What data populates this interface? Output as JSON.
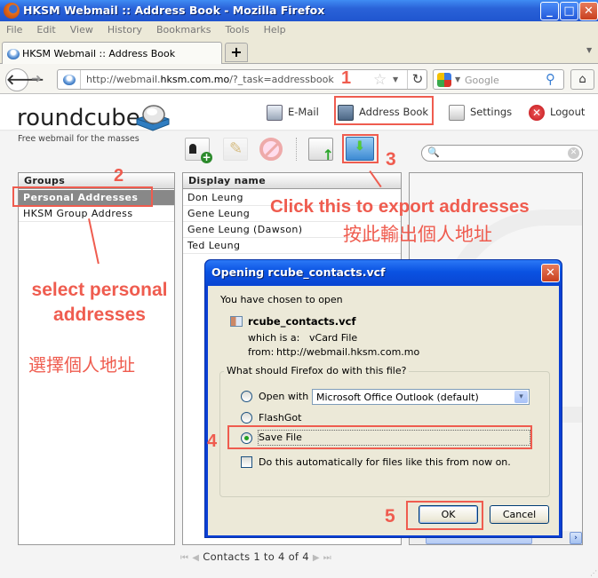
{
  "window": {
    "title": "HKSM Webmail :: Address Book - Mozilla Firefox",
    "controls": {
      "minimize": "_",
      "maximize": "□",
      "close": "✕"
    }
  },
  "menubar": {
    "items": [
      "File",
      "Edit",
      "View",
      "History",
      "Bookmarks",
      "Tools",
      "Help"
    ]
  },
  "tabs": {
    "items": [
      {
        "label": "HKSM Webmail :: Address Book"
      }
    ],
    "new_tab": "+",
    "overflow": "▼"
  },
  "navbar": {
    "back": "🡐",
    "forward": "➜",
    "url_prefix": "http://webmail.",
    "url_domain": "hksm.com.mo",
    "url_suffix": "/?_task=addressbook",
    "star": "☆",
    "dropdown": "▼",
    "reload": "↻",
    "search_placeholder": "Google",
    "search_dropdown": "▼",
    "search_icon": "⚲",
    "home": "⌂"
  },
  "roundcube": {
    "logo": "roundcube",
    "tagline": "Free webmail for the masses",
    "nav": [
      {
        "label": "E-Mail"
      },
      {
        "label": "Address Book"
      },
      {
        "label": "Settings"
      },
      {
        "label": "Logout",
        "icon_glyph": "✕"
      }
    ],
    "search_icon": "🔍",
    "search_reset": "✕"
  },
  "groups": {
    "header": "Groups",
    "items": [
      {
        "label": "Personal Addresses",
        "selected": true
      },
      {
        "label": "HKSM Group Address",
        "selected": false
      }
    ]
  },
  "contacts": {
    "header": "Display name",
    "rows": [
      "Don Leung",
      "Gene Leung",
      "Gene Leung (Dawson)",
      "Ted Leung"
    ],
    "pager": {
      "first": "⏮",
      "prev": "◀",
      "text": "Contacts 1 to 4 of 4",
      "next": "▶",
      "last": "⏭"
    }
  },
  "preview": {
    "scroll_right": "›",
    "scroll_grip": "|||"
  },
  "dialog": {
    "title": "Opening rcube_contacts.vcf",
    "close": "✕",
    "intro": "You have chosen to open",
    "filename": "rcube_contacts.vcf",
    "type_label": "which is a:",
    "type_value": "vCard File",
    "from_label": "from:",
    "from_value": "http://webmail.hksm.com.mo",
    "question": "What should Firefox do with this file?",
    "options": [
      {
        "label": "Open with",
        "selected": false
      },
      {
        "label": "FlashGot",
        "selected": false
      },
      {
        "label": "Save File",
        "selected": true
      }
    ],
    "open_with_app": "Microsoft Office Outlook (default)",
    "select_arrow": "▾",
    "auto_checkbox_label": "Do this automatically for files like this from now on.",
    "auto_checked": false,
    "ok_label": "OK",
    "cancel_label": "Cancel"
  },
  "annotations": {
    "step1": "1",
    "step2": "2",
    "step3": "3",
    "step4": "4",
    "step5": "5",
    "export_en": "Click this to export addresses",
    "export_zh": "按此輸出個人地址",
    "select_en": "select personal addresses",
    "select_zh": "選擇個人地址",
    "color": "#ef5c4f"
  }
}
